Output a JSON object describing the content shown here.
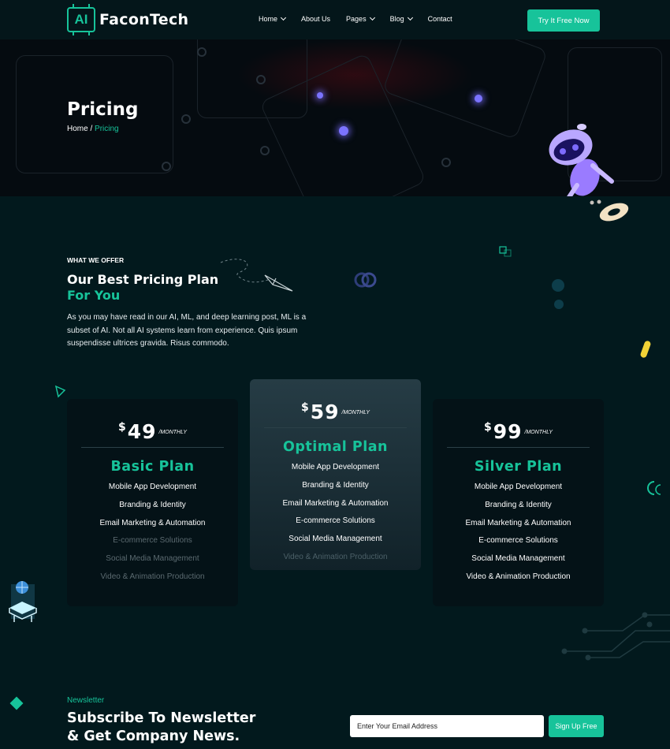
{
  "brand": {
    "logo_mark": "AI",
    "name": "FaconTech"
  },
  "nav": {
    "items": [
      {
        "label": "Home",
        "dropdown": true
      },
      {
        "label": "About Us",
        "dropdown": false
      },
      {
        "label": "Pages",
        "dropdown": true
      },
      {
        "label": "Blog",
        "dropdown": true
      },
      {
        "label": "Contact",
        "dropdown": false
      }
    ],
    "cta_label": "Try It Free Now"
  },
  "hero": {
    "title": "Pricing",
    "breadcrumb_home": "Home",
    "breadcrumb_separator": " / ",
    "breadcrumb_current": "Pricing"
  },
  "offer": {
    "tag": "WHAT WE OFFER",
    "title_line1": "Our Best Pricing Plan",
    "title_line2": "For You",
    "description": "As you may have read in our AI, ML, and deep learning post, ML is a subset of AI. Not all AI systems learn from experience. Quis ipsum suspendisse ultrices gravida. Risus commodo."
  },
  "plans": [
    {
      "currency": "$",
      "amount": "49",
      "period": "/MONTHLY",
      "name": "Basic Plan",
      "features": [
        {
          "label": "Mobile App Development",
          "included": true
        },
        {
          "label": "Branding & Identity",
          "included": true
        },
        {
          "label": "Email Marketing & Automation",
          "included": true
        },
        {
          "label": "E-commerce Solutions",
          "included": false
        },
        {
          "label": "Social Media Management",
          "included": false
        },
        {
          "label": "Video & Animation Production",
          "included": false
        }
      ]
    },
    {
      "currency": "$",
      "amount": "59",
      "period": "/MONTHLY",
      "name": "Optimal Plan",
      "features": [
        {
          "label": "Mobile App Development",
          "included": true
        },
        {
          "label": "Branding & Identity",
          "included": true
        },
        {
          "label": "Email Marketing & Automation",
          "included": true
        },
        {
          "label": "E-commerce Solutions",
          "included": true
        },
        {
          "label": "Social Media Management",
          "included": true
        },
        {
          "label": "Video & Animation Production",
          "included": false
        }
      ]
    },
    {
      "currency": "$",
      "amount": "99",
      "period": "/MONTHLY",
      "name": "Silver Plan",
      "features": [
        {
          "label": "Mobile App Development",
          "included": true
        },
        {
          "label": "Branding & Identity",
          "included": true
        },
        {
          "label": "Email Marketing & Automation",
          "included": true
        },
        {
          "label": "E-commerce Solutions",
          "included": true
        },
        {
          "label": "Social Media Management",
          "included": true
        },
        {
          "label": "Video & Animation Production",
          "included": true
        }
      ]
    }
  ],
  "newsletter": {
    "tag": "Newsletter",
    "title_line1": "Subscribe To Newsletter",
    "title_line2": "& Get Company News.",
    "email_placeholder": "Enter Your Email Address",
    "button_label": "Sign Up Free"
  },
  "icons": {
    "logo": "chip-icon",
    "nav_dropdown": "chevron-down-icon",
    "hero_robot": "robot-icon",
    "hero_gear": "gear-icon"
  },
  "colors": {
    "accent": "#17c39a",
    "background": "#02191d",
    "hero_background": "#050b10",
    "card_background": "#041217",
    "muted_feature": "#5b6a70"
  }
}
